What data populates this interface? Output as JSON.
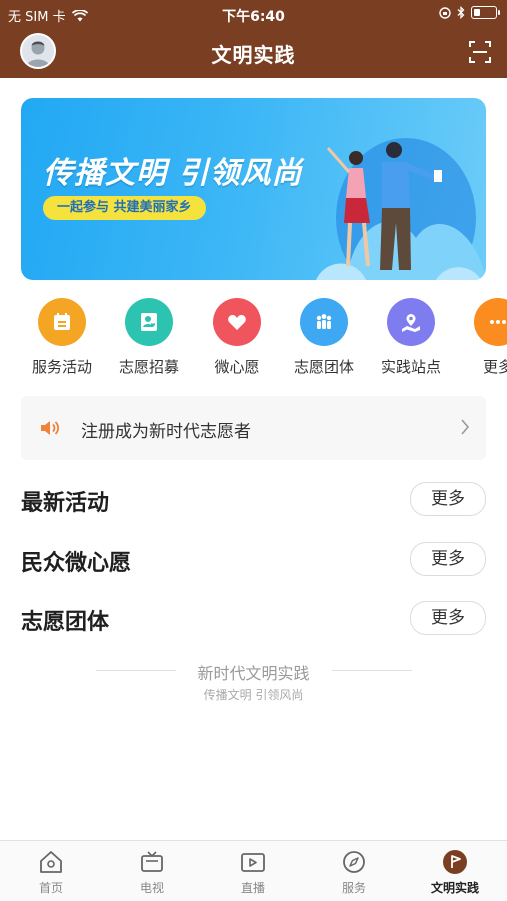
{
  "status_bar": {
    "carrier": "无 SIM 卡",
    "time": "下午6:40"
  },
  "nav": {
    "title": "文明实践"
  },
  "banner": {
    "title": "传播文明 引领风尚",
    "subtitle": "一起参与 共建美丽家乡"
  },
  "quick_icons": [
    {
      "label": "服务活动",
      "color": "#f5a524",
      "icon": "calendar-icon"
    },
    {
      "label": "志愿招募",
      "color": "#2cc3b0",
      "icon": "volunteer-icon"
    },
    {
      "label": "微心愿",
      "color": "#f0545c",
      "icon": "heart-icon"
    },
    {
      "label": "志愿团体",
      "color": "#3ea8f2",
      "icon": "group-icon"
    },
    {
      "label": "实践站点",
      "color": "#7f7cf0",
      "icon": "location-icon"
    },
    {
      "label": "更多",
      "color": "#fb8c1f",
      "icon": "more-icon"
    }
  ],
  "notice": {
    "text": "注册成为新时代志愿者"
  },
  "sections": [
    {
      "title": "最新活动",
      "more": "更多"
    },
    {
      "title": "民众微心愿",
      "more": "更多"
    },
    {
      "title": "志愿团体",
      "more": "更多"
    }
  ],
  "footer": {
    "title": "新时代文明实践",
    "subtitle": "传播文明 引领风尚"
  },
  "tabs": [
    {
      "label": "首页",
      "icon": "home-icon"
    },
    {
      "label": "电视",
      "icon": "tv-icon"
    },
    {
      "label": "直播",
      "icon": "live-icon"
    },
    {
      "label": "服务",
      "icon": "compass-icon"
    },
    {
      "label": "文明实践",
      "icon": "flag-icon",
      "active": true
    }
  ],
  "colors": {
    "brand": "#7a3f22",
    "banner_blue": "#22a8f3",
    "accent_yellow": "#f6e23c"
  }
}
